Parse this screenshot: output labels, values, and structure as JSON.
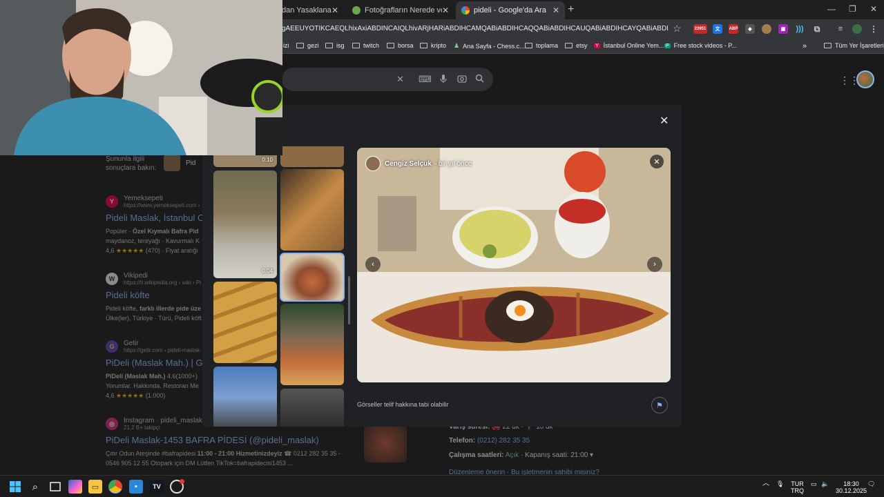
{
  "tabs": [
    {
      "title": "dan Yasaklanan Al"
    },
    {
      "title": "Fotoğrafların Nerede ve Ne Zam"
    },
    {
      "title": "pideli - Google'da Ara"
    }
  ],
  "omnibox": {
    "url": "gAEEUYOTIKCAEQLhixAxiABDINCAIQLhivARjHARiABDIHCAMQABiABDIHCAQQABiABDIHCAUQABiABDIHCAYQABiABDIHCAcQABiABD..."
  },
  "extensions": {
    "badge_count": "23951",
    "abp": "ABP"
  },
  "bookmarks": [
    {
      "label": "izi",
      "icon": "folder-icon"
    },
    {
      "label": "gezi",
      "icon": "folder-icon"
    },
    {
      "label": "isg",
      "icon": "folder-icon"
    },
    {
      "label": "twitch",
      "icon": "folder-icon"
    },
    {
      "label": "borsa",
      "icon": "folder-icon"
    },
    {
      "label": "kripto",
      "icon": "folder-icon"
    },
    {
      "label": "Ana Sayfa - Chess.c...",
      "icon": "chess-icon"
    },
    {
      "label": "toplama",
      "icon": "folder-icon"
    },
    {
      "label": "etsy",
      "icon": "folder-icon"
    },
    {
      "label": "İstanbul Online Yem...",
      "icon": "yemeksepeti-icon"
    },
    {
      "label": "Free stock videos - P...",
      "icon": "pexels-icon"
    }
  ],
  "bookmarks_overflow": "»",
  "all_bookmarks": "Tüm Yer İşaretleri",
  "related": {
    "label": "Şununla ilgili sonuçlara bakın:",
    "chip": "Pid"
  },
  "results": [
    {
      "source": "Yemeksepeti",
      "url": "https://www.yemeksepeti.com ›",
      "title": "Pideli Maslak, İstanbul O",
      "snippet_prefix": "Popüler · ",
      "snippet_bold": "Özel Kıymalı Bafra Pid",
      "snippet_rest": "maydanoz, tereyağı · Kavurmalı K",
      "rating": "4,6",
      "reviews": "(470)",
      "extra": "Fiyat aralığı",
      "logo_letter": "Y"
    },
    {
      "source": "Vikipedi",
      "url": "https://tr.wikipedia.org › wiki › Pi",
      "title": "Pideli köfte",
      "snippet_prefix": "Pideli köfte, ",
      "snippet_bold": "farklı illerde pide üze",
      "snippet_rest": "Ülke(ler), Türkiye · Türü, Pideli köft",
      "logo_letter": "W"
    },
    {
      "source": "Getir",
      "url": "https://getir.com › pideli-maslak-",
      "title": "PiDeli (Maslak Mah.) | Ge",
      "snippet_bold": "PiDeli (Maslak Mah.)",
      "snippet_rest": " 4.6(1000+)",
      "snippet_line2": "Yorumlar. Hakkında. Restoran Me",
      "rating": "4,6",
      "reviews": "(1.000)",
      "logo_letter": "G"
    },
    {
      "source": "Instagram · pideli_maslak",
      "url": "21,2 B+ takipçi",
      "title": "PiDeli Maslak-1453 BAFRA PİDESİ (@pideli_maslak)",
      "snippet_prefix": "Çıtır Odun Ateşinde #bafrapidesi ",
      "snippet_bold": "11:00 - 21:00 Hizmetinizdeyiz",
      "snippet_rest": " ☎ 0212 282 35 35 -",
      "snippet_line2": "0546 905 12 55 Otopark için DM Lütfen TikTok=bafrapidecisi1453 ...",
      "logo_letter": "◎"
    }
  ],
  "info": {
    "wait_label": "Varış süresi:",
    "wait_car": "22 dk",
    "wait_walk": "16 dk",
    "phone_label": "Telefon:",
    "phone": "(0212) 282 35 35",
    "hours_label": "Çalışma saatleri:",
    "hours_status": "Açık",
    "hours_rest": " · Kapanış saati: 21:00 ▾",
    "suggest": "Düzenleme önerin · Bu işletmenin sahibi misiniz?"
  },
  "viewer": {
    "author": "Cengiz Selçuk",
    "time": "· bir yıl önce",
    "copyright": "Görseller telif hakkına tabi olabilir",
    "thumb_video_time_1": "0:10",
    "thumb_video_time_2": "0:04"
  },
  "taskbar": {
    "lang_top": "TUR",
    "lang_bottom": "TRQ",
    "time": "18:30",
    "date": "30.12.2025"
  }
}
